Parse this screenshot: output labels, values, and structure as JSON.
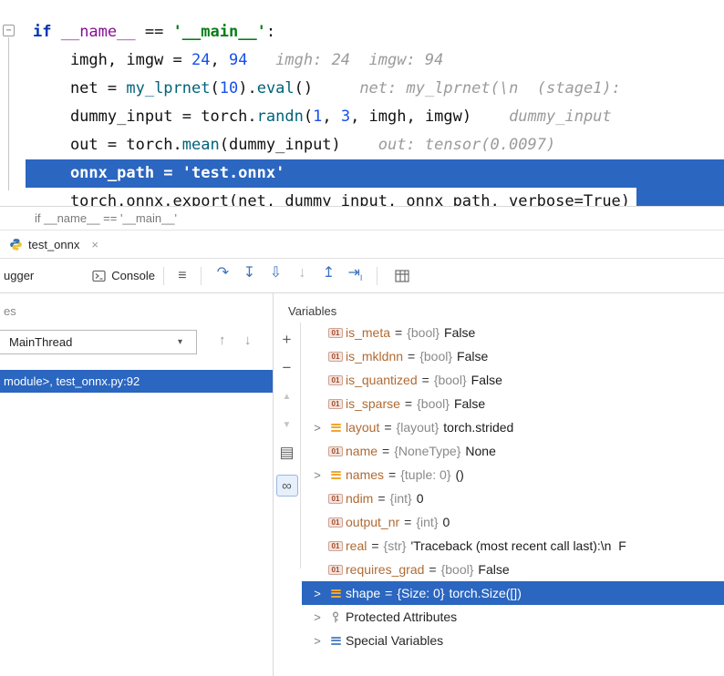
{
  "colors": {
    "selection": "#2b66c0",
    "keyword": "#0033b3",
    "string": "#067d17",
    "number": "#1750eb",
    "function": "#00627a",
    "dunder": "#871094",
    "hint": "#9b9b9b",
    "var_name": "#b06a32",
    "type": "#8a8a8a",
    "icon_yellow": "#f0a732",
    "badge_red": "#a5492c"
  },
  "editor": {
    "lines": [
      {
        "tokens": [
          [
            "kw",
            "if "
          ],
          [
            "dunder",
            "__name__"
          ],
          [
            "plain",
            " == "
          ],
          [
            "str",
            "'__main__'"
          ],
          [
            "plain",
            ":"
          ]
        ]
      },
      {
        "tokens": [
          [
            "plain",
            "    imgh, imgw = "
          ],
          [
            "num",
            "24"
          ],
          [
            "plain",
            ", "
          ],
          [
            "num",
            "94"
          ],
          [
            "hint",
            "   imgh: 24  imgw: 94"
          ]
        ]
      },
      {
        "tokens": [
          [
            "plain",
            "    net = "
          ],
          [
            "fn",
            "my_lprnet"
          ],
          [
            "plain",
            "("
          ],
          [
            "num",
            "10"
          ],
          [
            "plain",
            ")."
          ],
          [
            "fn",
            "eval"
          ],
          [
            "plain",
            "()"
          ],
          [
            "hint",
            "     net: my_lprnet(\\n  (stage1):"
          ]
        ]
      },
      {
        "tokens": [
          [
            "plain",
            "    dummy_input = torch."
          ],
          [
            "fn",
            "randn"
          ],
          [
            "plain",
            "("
          ],
          [
            "num",
            "1"
          ],
          [
            "plain",
            ", "
          ],
          [
            "num",
            "3"
          ],
          [
            "plain",
            ", imgh, imgw)"
          ],
          [
            "hint",
            "    dummy_input"
          ]
        ]
      },
      {
        "tokens": [
          [
            "plain",
            "    out = torch."
          ],
          [
            "fn",
            "mean"
          ],
          [
            "plain",
            "(dummy_input)"
          ],
          [
            "hint",
            "    out: tensor(0.0097)"
          ]
        ]
      },
      {
        "highlight": true,
        "tokens": [
          [
            "plain",
            "    onnx_path = "
          ],
          [
            "str",
            "'test.onnx'"
          ]
        ]
      },
      {
        "partial": true,
        "tokens": [
          [
            "plain",
            "    torch.onnx.export(net, dummy_input, onnx_path, verbose=True)"
          ]
        ]
      }
    ]
  },
  "breadcrumb": "if __name__ == '__main__'",
  "debug": {
    "tab": {
      "label": "test_onnx",
      "close": "×"
    },
    "toolbar": {
      "debugger_tab": "ugger",
      "console_tab": "Console",
      "menu_glyph": "≡",
      "steps": [
        {
          "name": "step-over-icon",
          "glyph": "↷",
          "style": "blue"
        },
        {
          "name": "step-into-icon",
          "glyph": "↧",
          "style": "blue"
        },
        {
          "name": "force-step-into-icon",
          "glyph": "⇩",
          "style": "blue"
        },
        {
          "name": "smart-step-into-icon",
          "glyph": "↓",
          "style": "gray"
        },
        {
          "name": "step-out-icon",
          "glyph": "↥",
          "style": "blue"
        },
        {
          "name": "run-to-cursor-icon",
          "glyph": "⇥",
          "sub": "I",
          "style": "blue"
        }
      ]
    },
    "frames": {
      "header": "es",
      "thread_selector": {
        "value": "MainThread",
        "arrow": "▾"
      },
      "selected_frame": "module>, test_onnx.py:92"
    },
    "variables": {
      "header": "Variables",
      "field_badge": "01",
      "expand_glyph": ">",
      "strip": [
        {
          "name": "new-watch-button",
          "glyph": "+",
          "style": "plain"
        },
        {
          "name": "remove-watch-button",
          "glyph": "−",
          "style": "plain"
        },
        {
          "name": "move-watch-up-button",
          "glyph": "▲",
          "style": "disabled"
        },
        {
          "name": "move-watch-down-button",
          "glyph": "▼",
          "style": "disabled"
        },
        {
          "name": "copy-value-button",
          "glyph": "▤",
          "style": "plain"
        },
        {
          "name": "show-watches-button",
          "glyph": "∞",
          "style": "active"
        }
      ],
      "rows": [
        {
          "icon": "field",
          "name": "is_meta",
          "type": "{bool}",
          "value": "False"
        },
        {
          "icon": "field",
          "name": "is_mkldnn",
          "type": "{bool}",
          "value": "False"
        },
        {
          "icon": "field",
          "name": "is_quantized",
          "type": "{bool}",
          "value": "False"
        },
        {
          "icon": "field",
          "name": "is_sparse",
          "type": "{bool}",
          "value": "False"
        },
        {
          "expand": true,
          "icon": "list",
          "name": "layout",
          "type": "{layout}",
          "value": "torch.strided"
        },
        {
          "icon": "field",
          "name": "name",
          "type": "{NoneType}",
          "value": "None"
        },
        {
          "expand": true,
          "icon": "tuple",
          "name": "names",
          "type": "{tuple: 0}",
          "value": "()"
        },
        {
          "icon": "field",
          "name": "ndim",
          "type": "{int}",
          "value": "0"
        },
        {
          "icon": "field",
          "name": "output_nr",
          "type": "{int}",
          "value": "0"
        },
        {
          "icon": "field",
          "name": "real",
          "type": "{str}",
          "value": "'Traceback (most recent call last):\\n  F"
        },
        {
          "icon": "field",
          "name": "requires_grad",
          "type": "{bool}",
          "value": "False"
        },
        {
          "expand": true,
          "icon": "list",
          "name": "shape",
          "type": "{Size: 0}",
          "value": "torch.Size([])",
          "selected": true
        },
        {
          "expand": true,
          "icon": "key",
          "name": "Protected Attributes",
          "group": true
        },
        {
          "expand": true,
          "icon": "special",
          "name": "Special Variables",
          "group": true
        }
      ]
    }
  }
}
